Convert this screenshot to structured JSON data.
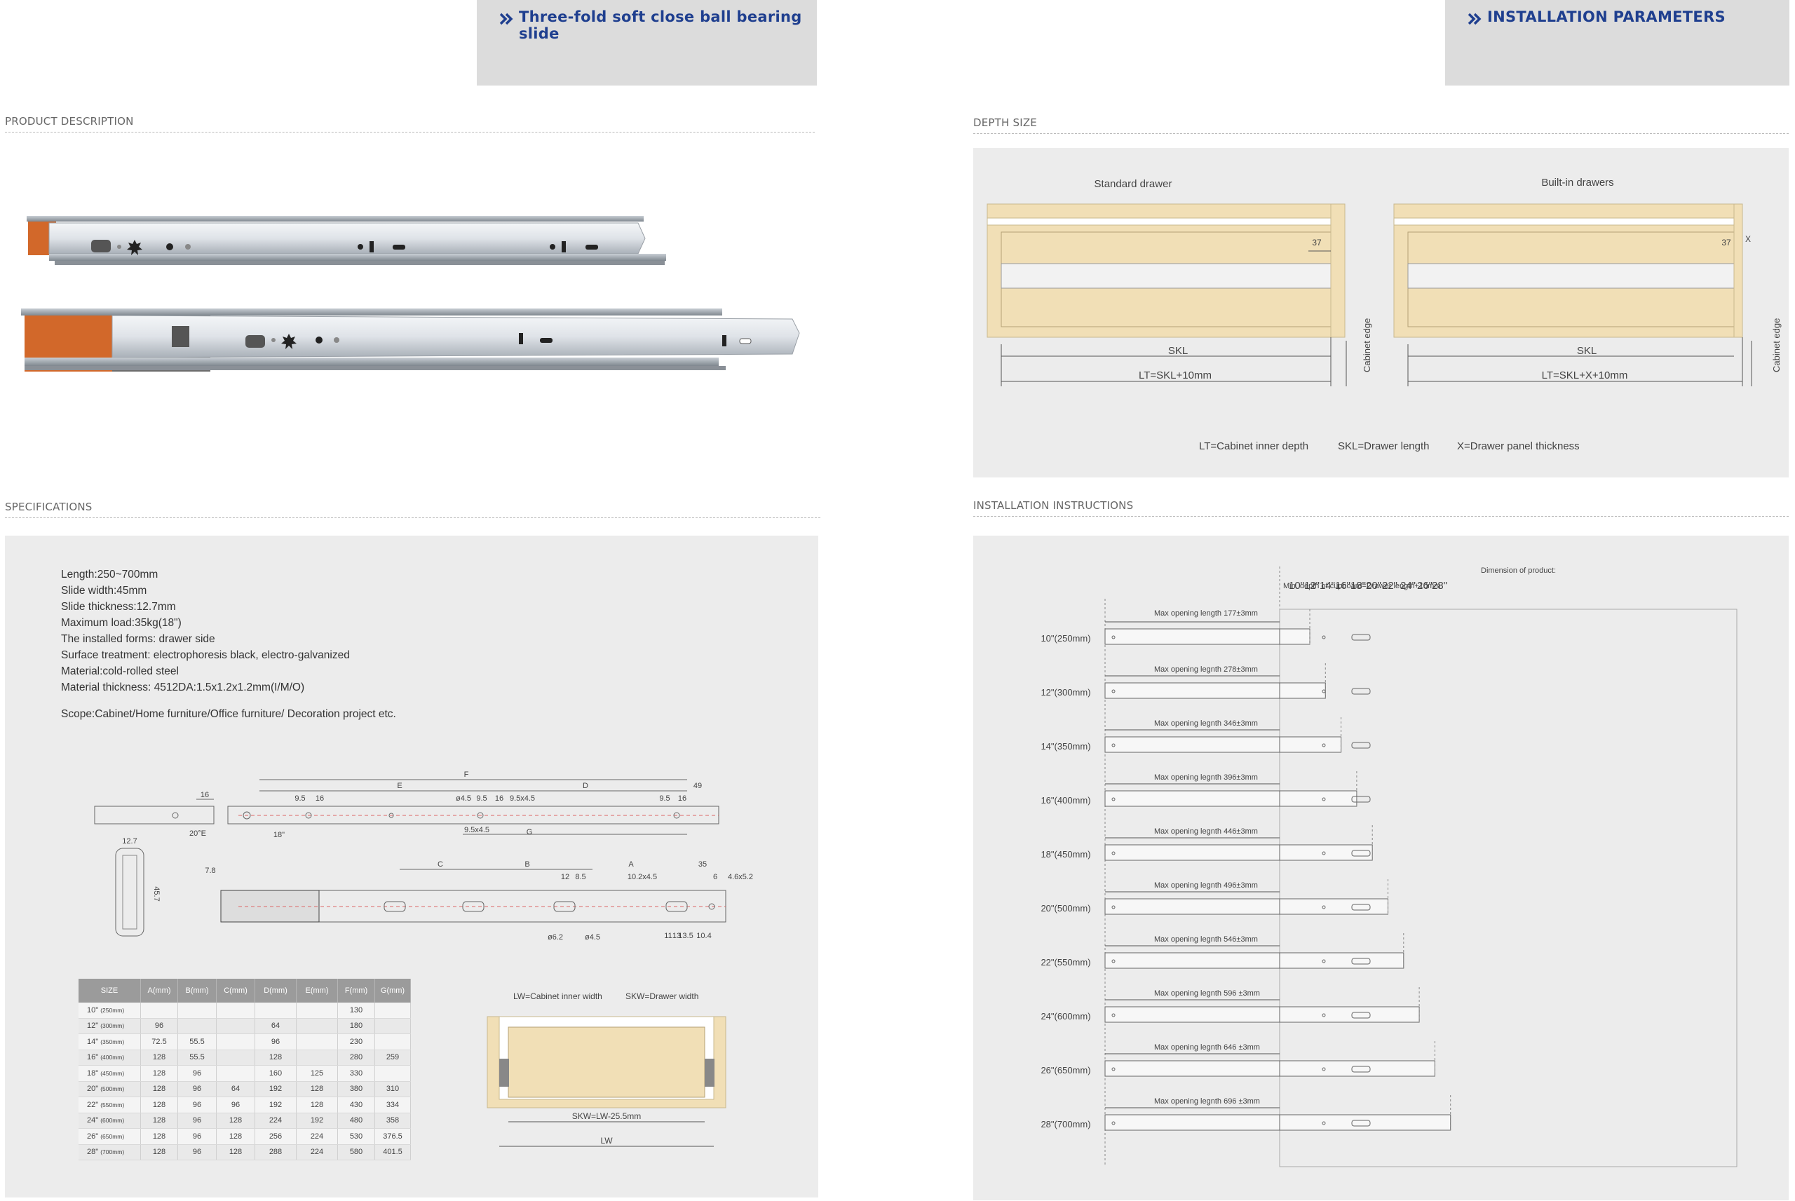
{
  "header_left": {
    "title": "Three-fold soft close ball bearing slide"
  },
  "header_right": {
    "title": "INSTALLATION PARAMETERS"
  },
  "sections": {
    "product_description": "PRODUCT DESCRIPTION",
    "depth_size": "DEPTH SIZE",
    "specifications": "SPECIFICATIONS",
    "installation_instructions": "INSTALLATION INSTRUCTIONS"
  },
  "specs": {
    "lines": [
      "Length:250~700mm",
      "Slide width:45mm",
      "Slide thickness:12.7mm",
      "Maximum load:35kg(18\")",
      "The installed forms: drawer side",
      "Surface treatment: electrophoresis black, electro-galvanized",
      "Material:cold-rolled steel",
      "Material thickness: 4512DA:1.5x1.2x1.2mm(I/M/O)"
    ],
    "scope": "Scope:Cabinet/Home furniture/Office furniture/ Decoration project etc."
  },
  "depth": {
    "standard_title": "Standard drawer",
    "builtin_title": "Built-in drawers",
    "dim37": "37",
    "x_label": "X",
    "skl": "SKL",
    "lt_standard": "LT=SKL+10mm",
    "lt_builtin": "LT=SKL+X+10mm",
    "cabinet_edge": "Cabinet edge",
    "legend": {
      "lt": "LT=Cabinet inner depth",
      "skl": "SKL=Drawer length",
      "x": "X=Drawer panel thickness"
    }
  },
  "drawing_labels": {
    "F": "F",
    "E": "E",
    "D": "D",
    "G": "G",
    "C": "C",
    "B": "B",
    "A": "A",
    "d16": "16",
    "d49": "49",
    "d95a": "9.5",
    "d16b": "16",
    "d45": "ø4.5",
    "d95b": "9.5",
    "d16c": "16",
    "d95x45": "9.5x4.5",
    "d95c": "9.5",
    "d16d": "16",
    "d18": "18\"",
    "d95x45b": "9.5x4.5",
    "d20e": "20°E",
    "d127": "12.7",
    "d457": "45.7",
    "d78": "7.8",
    "d12": "12",
    "d85": "8.5",
    "d102": "10.2x4.5",
    "d35": "35",
    "d6": "6",
    "d46": "4.6x5.2",
    "d62": "ø6.2",
    "d45b": "ø4.5",
    "d11": "11",
    "d13": "13",
    "d135": "13.5",
    "d104": "10.4"
  },
  "table": {
    "headers": [
      "SIZE",
      "A(mm)",
      "B(mm)",
      "C(mm)",
      "D(mm)",
      "E(mm)",
      "F(mm)",
      "G(mm)"
    ],
    "rows": [
      [
        "10\"",
        "(250mm)",
        "",
        "",
        "",
        "",
        "",
        "130",
        ""
      ],
      [
        "12\"",
        "(300mm)",
        "96",
        "",
        "",
        "64",
        "",
        "180",
        ""
      ],
      [
        "14\"",
        "(350mm)",
        "72.5",
        "55.5",
        "",
        "96",
        "",
        "230",
        ""
      ],
      [
        "16\"",
        "(400mm)",
        "128",
        "55.5",
        "",
        "128",
        "",
        "280",
        "259"
      ],
      [
        "18\"",
        "(450mm)",
        "128",
        "96",
        "",
        "160",
        "125",
        "330",
        ""
      ],
      [
        "20\"",
        "(500mm)",
        "128",
        "96",
        "64",
        "192",
        "128",
        "380",
        "310"
      ],
      [
        "22\"",
        "(550mm)",
        "128",
        "96",
        "96",
        "192",
        "128",
        "430",
        "334"
      ],
      [
        "24\"",
        "(600mm)",
        "128",
        "96",
        "128",
        "224",
        "192",
        "480",
        "358"
      ],
      [
        "26\"",
        "(650mm)",
        "128",
        "96",
        "128",
        "256",
        "224",
        "530",
        "376.5"
      ],
      [
        "28\"",
        "(700mm)",
        "128",
        "96",
        "128",
        "288",
        "224",
        "580",
        "401.5"
      ]
    ]
  },
  "width_diagram": {
    "lw_label": "LW=Cabinet inner width",
    "skw_label": "SKW=Drawer width",
    "skw_formula": "SKW=LW-25.5mm",
    "lw": "LW"
  },
  "install": {
    "dimension_title": "Dimension of product:",
    "min_depth": "Min. depth of cupboard=Drawer length+10mm",
    "size_cols": [
      "10\"",
      "12\"",
      "14\"",
      "16\"",
      "18\"",
      "20\"",
      "22\"",
      "24\"",
      "26\"",
      "28\""
    ],
    "rows": [
      {
        "size": "10\"(250mm)",
        "opening": "Max opening length 177±3mm"
      },
      {
        "size": "12\"(300mm)",
        "opening": "Max opening legnth 278±3mm"
      },
      {
        "size": "14\"(350mm)",
        "opening": "Max opening legnth 346±3mm"
      },
      {
        "size": "16\"(400mm)",
        "opening": "Max opening legnth 396±3mm"
      },
      {
        "size": "18\"(450mm)",
        "opening": "Max opening legnth 446±3mm"
      },
      {
        "size": "20\"(500mm)",
        "opening": "Max opening legnth 496±3mm"
      },
      {
        "size": "22\"(550mm)",
        "opening": "Max opening legnth 546±3mm"
      },
      {
        "size": "24\"(600mm)",
        "opening": "Max opening legnth 596 ±3mm"
      },
      {
        "size": "26\"(650mm)",
        "opening": "Max opening legnth 646 ±3mm"
      },
      {
        "size": "28\"(700mm)",
        "opening": "Max opening legnth 696 ±3mm"
      }
    ]
  },
  "colors": {
    "accent": "#1f3f8f",
    "banner": "#dcdcdc",
    "panel": "#ececec",
    "wood": "#f1dfb6",
    "wood_edge": "#c9b88e",
    "orange": "#d2682a"
  }
}
